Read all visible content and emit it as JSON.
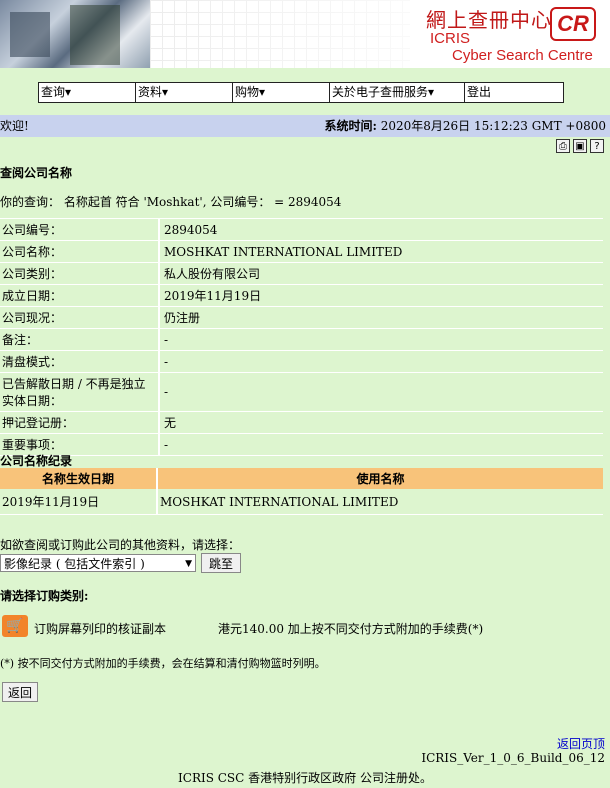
{
  "banner": {
    "logo_zh": "網上查冊中心",
    "logo_cr": "CR",
    "logo_icris": "ICRIS",
    "logo_cyber": "Cyber Search Centre"
  },
  "menu": [
    "查询▾",
    "资料▾",
    "购物▾",
    "关於电子查冊服务▾",
    "登出"
  ],
  "welcome": "欢迎!",
  "system_time_label": "系统时间:",
  "system_time_value": " 2020年8月26日 15:12:23 GMT +0800",
  "tools": {
    "print": "print-icon",
    "save": "save-icon",
    "help": "help-icon"
  },
  "page_title": "查阅公司名称",
  "query": "你的查询： 名称起首 符合 'Moshkat', 公司编号： = 2894054",
  "info_rows": [
    {
      "k": "公司编号：",
      "v": "2894054"
    },
    {
      "k": "公司名称：",
      "v": "MOSHKAT INTERNATIONAL LIMITED"
    },
    {
      "k": "公司类别：",
      "v": "私人股份有限公司"
    },
    {
      "k": "成立日期：",
      "v": "2019年11月19日"
    },
    {
      "k": "公司现况：",
      "v": "仍注册"
    },
    {
      "k": "备注：",
      "v": "-"
    },
    {
      "k": "清盘模式：",
      "v": "-"
    },
    {
      "k": "已告解散日期 / 不再是独立实体日期：",
      "v": "-"
    },
    {
      "k": "押记登记册：",
      "v": "无"
    },
    {
      "k": "重要事项：",
      "v": "-"
    }
  ],
  "name_record": {
    "title": "公司名称纪录",
    "col1": "名称生效日期",
    "col2": "使用名称",
    "rows": [
      {
        "date": "2019年11月19日",
        "name": "MOSHKAT INTERNATIONAL LIMITED"
      }
    ]
  },
  "choose_label": "如欲查阅或订购此公司的其他资料，请选择：",
  "select_value": "影像纪录 ( 包括文件索引 )",
  "goto_button": "跳至",
  "order_title": "请选择订购类别:",
  "order_item": "订购屏幕列印的核证副本",
  "order_price": "港元140.00 加上按不同交付方式附加的手续费(*)",
  "footnote": "(*) 按不同交付方式附加的手续费，会在结算和清付购物篮时列明。",
  "back_button": "返回",
  "top_link": "返回页顶",
  "version": "ICRIS_Ver_1_0_6_Build_06_12",
  "footer": "ICRIS CSC 香港特别行政区政府 公司注册处。"
}
